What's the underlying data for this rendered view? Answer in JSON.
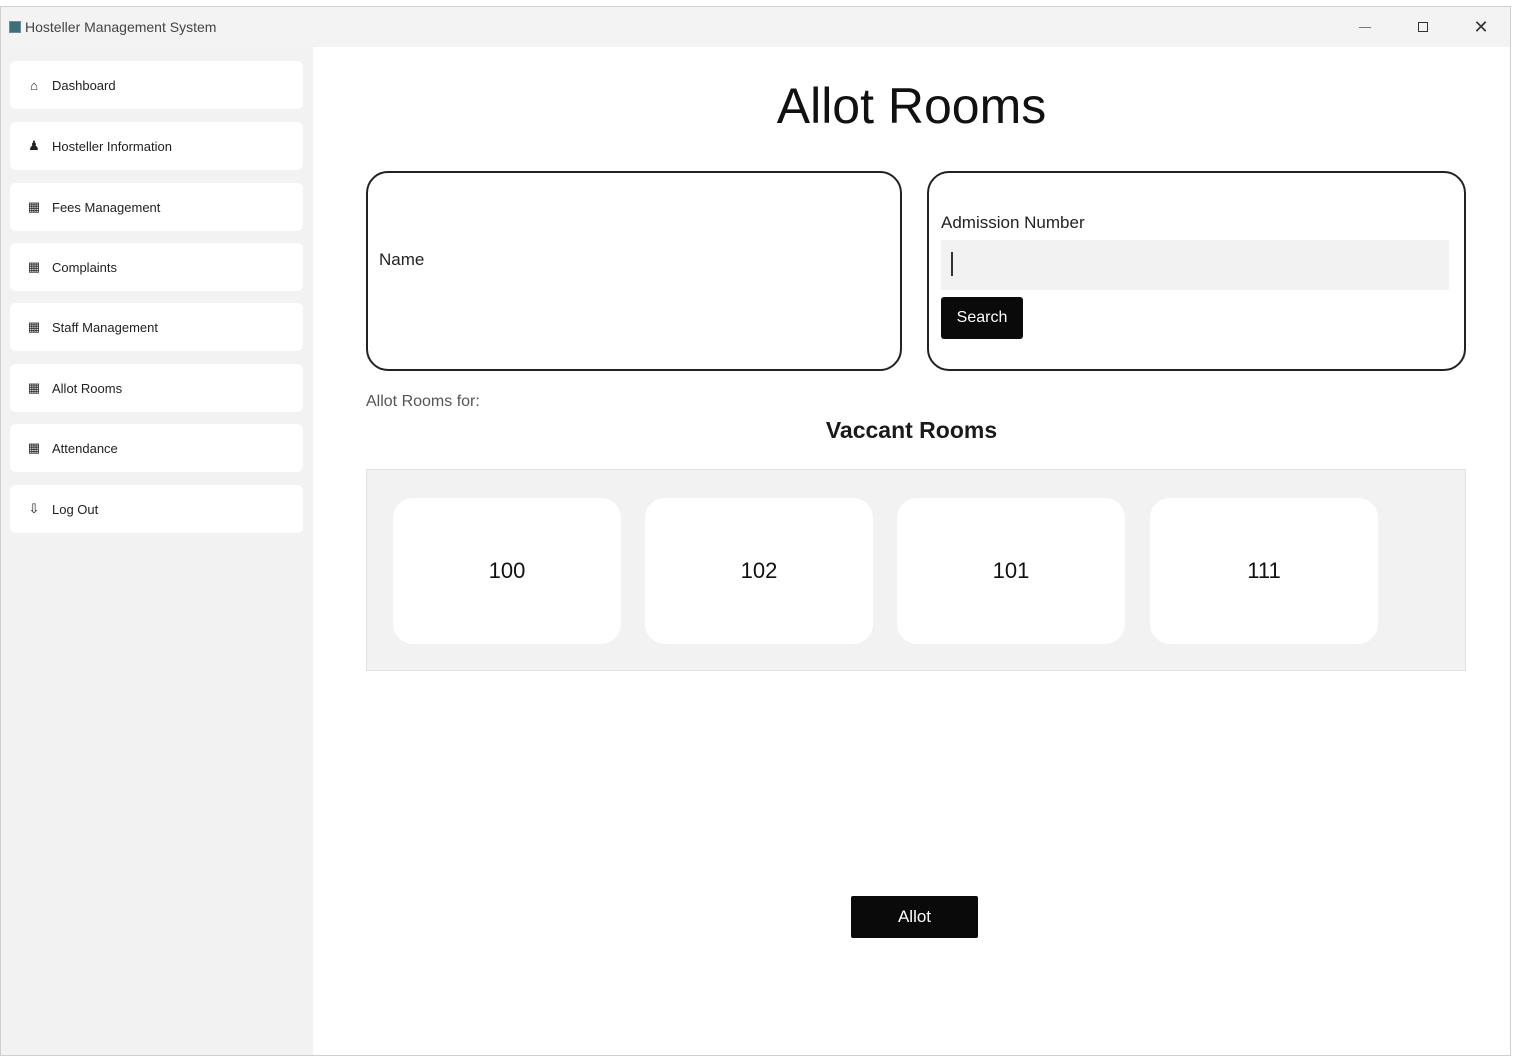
{
  "window": {
    "title": "Hosteller Management System",
    "controls": {
      "minimize": "—",
      "maximize": "",
      "close": "✕"
    }
  },
  "sidebar": {
    "items": [
      {
        "label": "Dashboard",
        "icon": "home-icon",
        "glyph": "⌂"
      },
      {
        "label": "Hosteller Information",
        "icon": "person-icon",
        "glyph": "♟"
      },
      {
        "label": "Fees Management",
        "icon": "grid-icon",
        "glyph": "▦"
      },
      {
        "label": "Complaints",
        "icon": "grid-icon",
        "glyph": "▦"
      },
      {
        "label": "Staff Management",
        "icon": "grid-icon",
        "glyph": "▦"
      },
      {
        "label": "Allot Rooms",
        "icon": "grid-icon",
        "glyph": "▦"
      },
      {
        "label": "Attendance",
        "icon": "grid-icon",
        "glyph": "▦"
      },
      {
        "label": "Log Out",
        "icon": "logout-icon",
        "glyph": "⇩"
      }
    ]
  },
  "main": {
    "title": "Allot Rooms",
    "name_card": {
      "label": "Name"
    },
    "admission_card": {
      "label": "Admission Number",
      "value": "",
      "search_label": "Search"
    },
    "allot_for_label": "Allot Rooms for:",
    "vacant_heading": "Vaccant Rooms",
    "rooms": [
      "100",
      "102",
      "101",
      "111"
    ],
    "allot_button": "Allot"
  }
}
